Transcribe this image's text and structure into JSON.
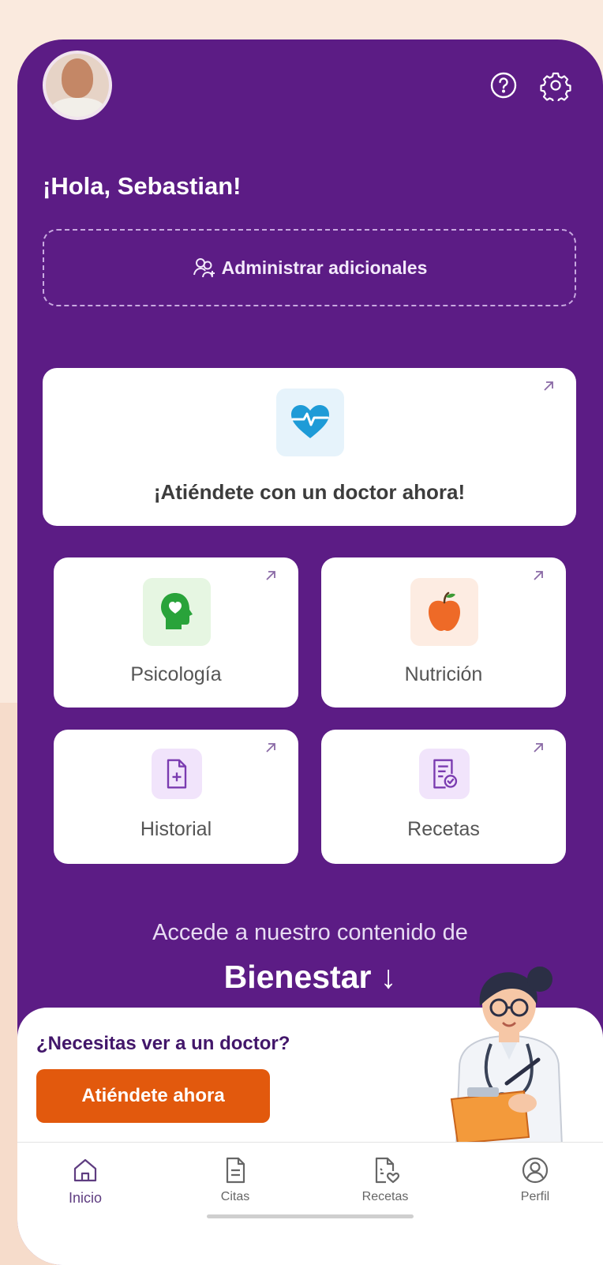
{
  "header": {
    "avatar_icon": "user-avatar",
    "help_icon": "help-circle-icon",
    "settings_icon": "gear-icon",
    "greeting": "¡Hola, Sebastian!"
  },
  "manage": {
    "icon": "people-add-icon",
    "label": "Administrar adicionales"
  },
  "services": {
    "doctor_now": {
      "label": "¡Atiéndete con un doctor ahora!",
      "icon": "heart-pulse-icon"
    },
    "psychology": {
      "label": "Psicología",
      "icon": "head-heart-icon"
    },
    "nutrition": {
      "label": "Nutrición",
      "icon": "apple-icon"
    },
    "history": {
      "label": "Historial",
      "icon": "document-plus-icon"
    },
    "prescriptions": {
      "label": "Recetas",
      "icon": "prescription-icon"
    }
  },
  "wellness": {
    "line1": "Accede a nuestro contenido de",
    "line2": "Bienestar ↓"
  },
  "promo": {
    "title": "¿Necesitas ver a un doctor?",
    "button": "Atiéndete ahora",
    "illustration": "doctor-illustration"
  },
  "nav": {
    "items": [
      {
        "label": "Inicio",
        "icon": "home-icon"
      },
      {
        "label": "Citas",
        "icon": "document-icon"
      },
      {
        "label": "Recetas",
        "icon": "prescription-heart-icon"
      },
      {
        "label": "Perfil",
        "icon": "profile-icon"
      }
    ]
  },
  "colors": {
    "primary": "#5c1c85",
    "accent": "#e2590d",
    "heart_blue": "#1e9bd7",
    "psych_green": "#29a33a",
    "apple_orange": "#ee6a27",
    "tile_purple": "#7a3bb0"
  }
}
